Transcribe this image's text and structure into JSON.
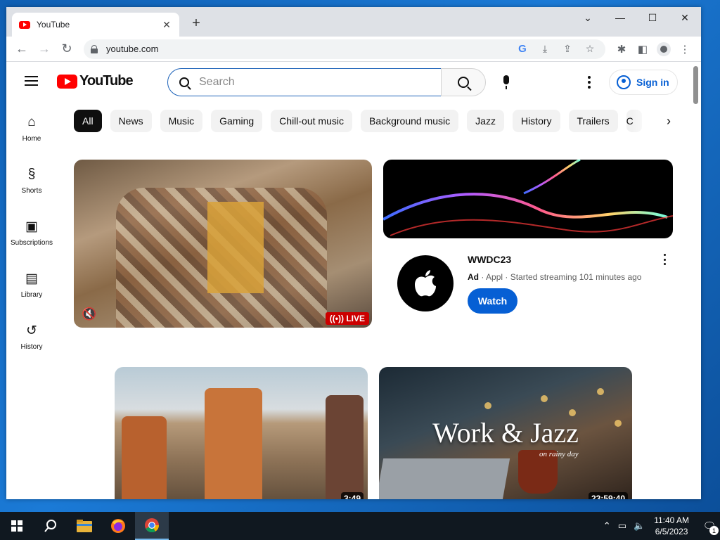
{
  "browser": {
    "tab_title": "YouTube",
    "tab_close": "✕",
    "new_tab": "+",
    "url": "youtube.com",
    "window_controls": {
      "dropdown": "⌄",
      "minimize": "—",
      "maximize": "☐",
      "close": "✕"
    }
  },
  "youtube": {
    "logo_text": "YouTube",
    "search_placeholder": "Search",
    "sign_in": "Sign in",
    "nav": [
      {
        "label": "Home",
        "icon": "⌂"
      },
      {
        "label": "Shorts",
        "icon": "§"
      },
      {
        "label": "Subscriptions",
        "icon": "▣"
      },
      {
        "label": "Library",
        "icon": "▤"
      },
      {
        "label": "History",
        "icon": "↺"
      }
    ],
    "chips": [
      "All",
      "News",
      "Music",
      "Gaming",
      "Chill-out music",
      "Background music",
      "Jazz",
      "History",
      "Trailers",
      "C"
    ],
    "live_video": {
      "badge": "((•)) LIVE",
      "mute_icon": "🔇"
    },
    "ad": {
      "title": "WWDC23",
      "ad_label": "Ad",
      "meta": "· Appl · Started streaming 101 minutes ago",
      "cta": "Watch"
    },
    "videos": [
      {
        "duration": "3:49"
      },
      {
        "duration": "23:59:40",
        "overlay_title": "Work & Jazz",
        "overlay_sub": "on rainy day"
      }
    ]
  },
  "taskbar": {
    "time": "11:40 AM",
    "date": "6/5/2023",
    "notification_count": "1"
  },
  "colors": {
    "yt_red": "#ff0000",
    "link_blue": "#065fd4",
    "chip_active": "#0f0f0f"
  }
}
